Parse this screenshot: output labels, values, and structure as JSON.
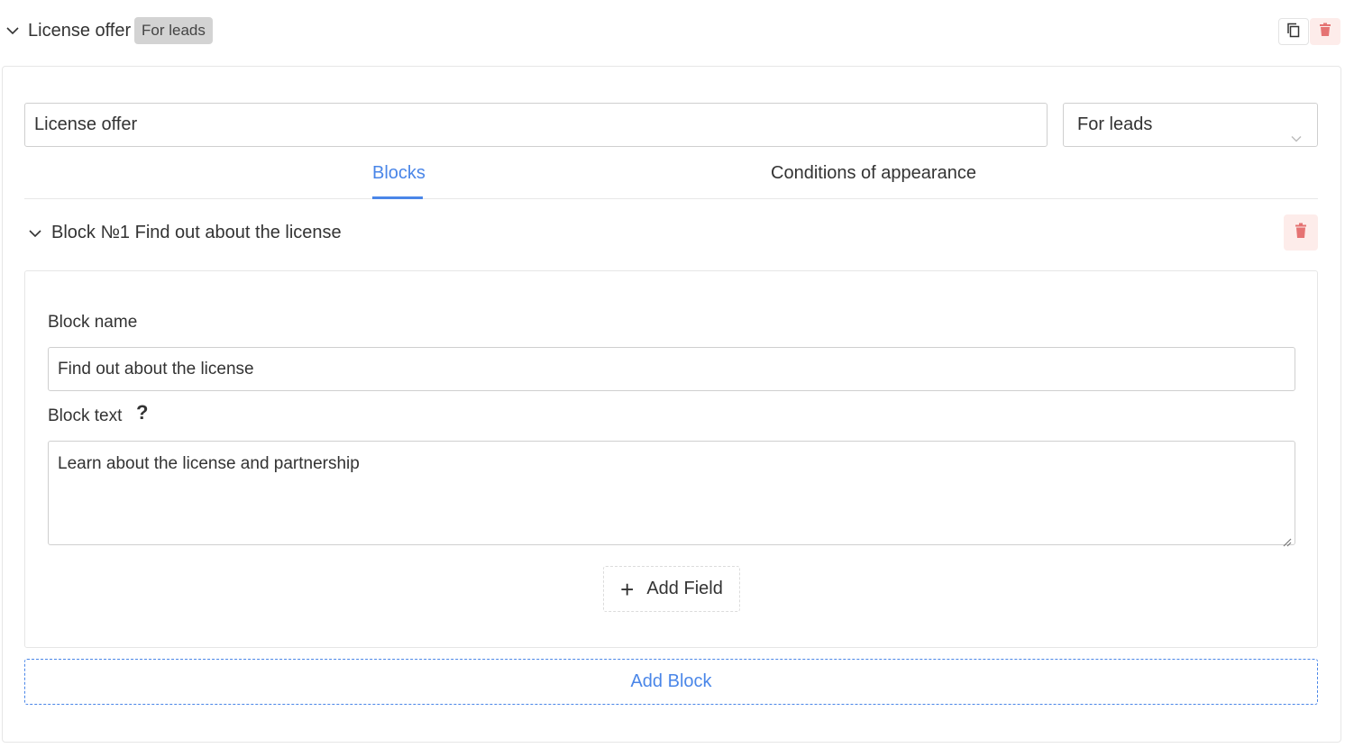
{
  "header": {
    "title": "License offer",
    "badge": "For leads"
  },
  "form": {
    "name_value": "License offer",
    "audience_value": "For leads"
  },
  "tabs": [
    {
      "label": "Blocks",
      "active": true
    },
    {
      "label": "Conditions of appearance",
      "active": false
    }
  ],
  "block": {
    "title": "Block №1 Find out about the license",
    "name_label": "Block name",
    "name_value": "Find out about the license",
    "text_label": "Block text",
    "help_mark": "?",
    "text_value": "Learn about the license and partnership",
    "add_field_label": "Add Field",
    "add_field_plus": "+"
  },
  "add_block_label": "Add Block",
  "colors": {
    "accent": "#4a86e8",
    "danger": "#e57373",
    "danger_bg": "#fdecea",
    "badge_bg": "#d3d3d3"
  },
  "icons": {
    "collapse": "chevron-down-icon",
    "copy": "copy-icon",
    "delete": "trash-icon",
    "help": "question-mark-icon",
    "add": "plus-icon"
  }
}
